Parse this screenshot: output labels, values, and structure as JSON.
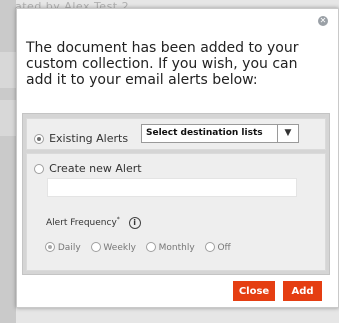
{
  "background": {
    "partial_text": "ated by Alex Test 2"
  },
  "modal": {
    "close_icon": "close-icon",
    "message": "The document has been added to your custom collection. If you wish, you can add it to your email alerts below:",
    "existing_alerts": {
      "label": "Existing Alerts",
      "selected": true,
      "select_value": "Select destination lists",
      "arrow_glyph": "▼"
    },
    "create_new": {
      "label": "Create new Alert",
      "selected": false,
      "name_value": "",
      "frequency_label": "Alert Frequency",
      "required_mark": "*",
      "info_glyph": "i",
      "options": [
        "Daily",
        "Weekly",
        "Monthly",
        "Off"
      ],
      "selected_option": "Daily"
    },
    "buttons": {
      "close": "Close",
      "add": "Add"
    },
    "colors": {
      "button": "#e53e12",
      "panel": "#d5d5d5",
      "section": "#eeeeee"
    }
  }
}
